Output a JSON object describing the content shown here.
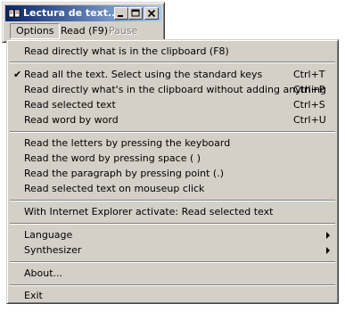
{
  "window": {
    "title": "Lectura de text...",
    "menubar": {
      "options": "Options",
      "read": "Read (F9)",
      "pause": "Pause"
    }
  },
  "dropdown": {
    "items": [
      {
        "label": "Read directly what is in the clipboard (F8)",
        "shortcut": "",
        "checked": false,
        "submenu": false
      },
      {
        "label": "Read all the text. Select using the standard keys",
        "shortcut": "Ctrl+T",
        "checked": true,
        "submenu": false
      },
      {
        "label": "Read directly what's in the clipboard without adding anything",
        "shortcut": "Ctrl+P",
        "checked": false,
        "submenu": false
      },
      {
        "label": "Read selected text",
        "shortcut": "Ctrl+S",
        "checked": false,
        "submenu": false
      },
      {
        "label": "Read word by word",
        "shortcut": "Ctrl+U",
        "checked": false,
        "submenu": false
      },
      {
        "label": "Read the letters by pressing the keyboard",
        "shortcut": "",
        "checked": false,
        "submenu": false
      },
      {
        "label": "Read the word by pressing space ( )",
        "shortcut": "",
        "checked": false,
        "submenu": false
      },
      {
        "label": "Read the paragraph by pressing point (.)",
        "shortcut": "",
        "checked": false,
        "submenu": false
      },
      {
        "label": "Read selected text on mouseup click",
        "shortcut": "",
        "checked": false,
        "submenu": false
      },
      {
        "label": "With Internet Explorer activate: Read selected text",
        "shortcut": "",
        "checked": false,
        "submenu": false
      },
      {
        "label": "Language",
        "shortcut": "",
        "checked": false,
        "submenu": true
      },
      {
        "label": "Synthesizer",
        "shortcut": "",
        "checked": false,
        "submenu": true
      },
      {
        "label": "About...",
        "shortcut": "",
        "checked": false,
        "submenu": false
      },
      {
        "label": "Exit",
        "shortcut": "",
        "checked": false,
        "submenu": false
      }
    ],
    "check_glyph": "✔"
  },
  "colors": {
    "face": "#d4d0c8",
    "title_start": "#0a246a",
    "title_end": "#a6caf0",
    "disabled": "#808080"
  }
}
